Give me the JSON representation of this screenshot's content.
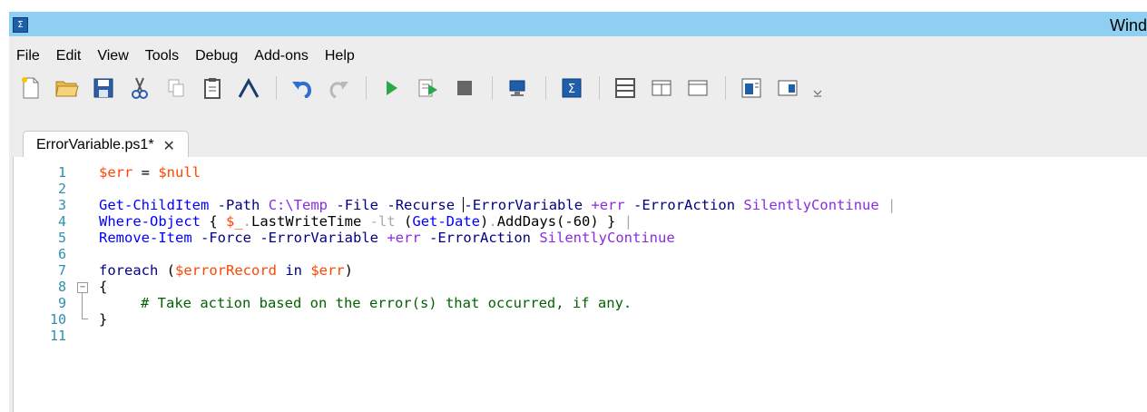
{
  "window": {
    "title": "Wind",
    "app_icon": "powershell-ise-icon",
    "accent_color": "#8fd0f2"
  },
  "menu": [
    "File",
    "Edit",
    "View",
    "Tools",
    "Debug",
    "Add-ons",
    "Help"
  ],
  "toolbar": {
    "buttons": [
      "new-script-icon",
      "open-icon",
      "save-icon",
      "cut-icon",
      "copy-icon",
      "paste-icon",
      "clear-console-icon",
      "undo-icon",
      "redo-icon",
      "run-script-icon",
      "run-selection-icon",
      "stop-icon",
      "remote-powershell-icon",
      "powershell-console-icon",
      "show-script-top-icon",
      "show-script-right-icon",
      "show-script-maximized-icon",
      "show-script-pane-icon",
      "show-command-addon-icon",
      "toolbar-overflow-icon"
    ]
  },
  "tabs": [
    {
      "label": "ErrorVariable.ps1*",
      "close": "✕",
      "active": true
    }
  ],
  "editor": {
    "line_numbers": [
      "1",
      "2",
      "3",
      "4",
      "5",
      "6",
      "7",
      "8",
      "9",
      "10",
      "11"
    ],
    "fold_marker": "−",
    "line1": {
      "a": "$err",
      "b": " = ",
      "c": "$null"
    },
    "line3": {
      "cmd": "Get-ChildItem",
      "p1": "-Path",
      "a1": "C:\\Temp",
      "p2": "-File",
      "p3": "-Recurse",
      "p4": "-ErrorVariable",
      "a4": "+err",
      "p5": "-ErrorAction",
      "a5": "SilentlyContinue",
      "pipe": "|"
    },
    "line4": {
      "cmd": "Where-Object",
      "b1": " { ",
      "var": "$_",
      "dot": ".",
      "mem": "LastWriteTime",
      "op": "-lt",
      "p1": "(",
      "cmd2": "Get-Date",
      "p2": ")",
      "dot2": ".",
      "mem2": "AddDays",
      "p3": "(",
      "num": "-60",
      "p4": ")",
      "b2": " }",
      "pipe": "|"
    },
    "line5": {
      "cmd": "Remove-Item",
      "p1": "-Force",
      "p2": "-ErrorVariable",
      "a2": "+err",
      "p3": "-ErrorAction",
      "a3": "SilentlyContinue"
    },
    "line7": {
      "kw": "foreach",
      "p1": " (",
      "v1": "$errorRecord",
      "kw2": "in",
      "v2": "$err",
      "p2": ")"
    },
    "line8": {
      "brace": "{"
    },
    "line9": {
      "comment": "# Take action based on the error(s) that occurred, if any."
    },
    "line10": {
      "brace": "}"
    }
  }
}
